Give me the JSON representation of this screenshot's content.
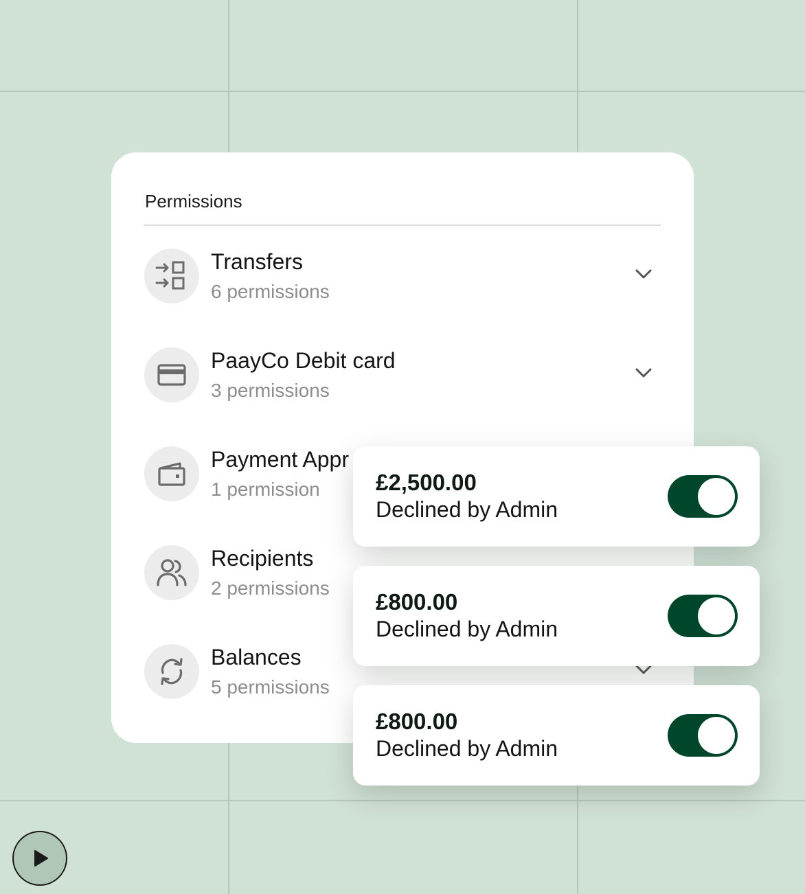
{
  "colors": {
    "background": "#d0e1d6",
    "accent": "#00462a",
    "muted_text": "#8d8d8d"
  },
  "permissions": {
    "title": "Permissions",
    "items": [
      {
        "name": "Transfers",
        "count": "6 permissions",
        "icon": "transfer-icon"
      },
      {
        "name": "PaayCo Debit card",
        "count": "3 permissions",
        "icon": "card-icon"
      },
      {
        "name": "Payment Appr",
        "count": "1 permission",
        "icon": "wallet-icon"
      },
      {
        "name": "Recipients",
        "count": "2 permissions",
        "icon": "users-icon"
      },
      {
        "name": "Balances",
        "count": "5 permissions",
        "icon": "refresh-icon"
      }
    ]
  },
  "notifications": [
    {
      "amount": "£2,500.00",
      "status": "Declined by Admin",
      "enabled": true
    },
    {
      "amount": "£800.00",
      "status": "Declined by Admin",
      "enabled": true
    },
    {
      "amount": "£800.00",
      "status": "Declined by Admin",
      "enabled": true
    }
  ],
  "controls": {
    "play_icon": "play-icon"
  }
}
